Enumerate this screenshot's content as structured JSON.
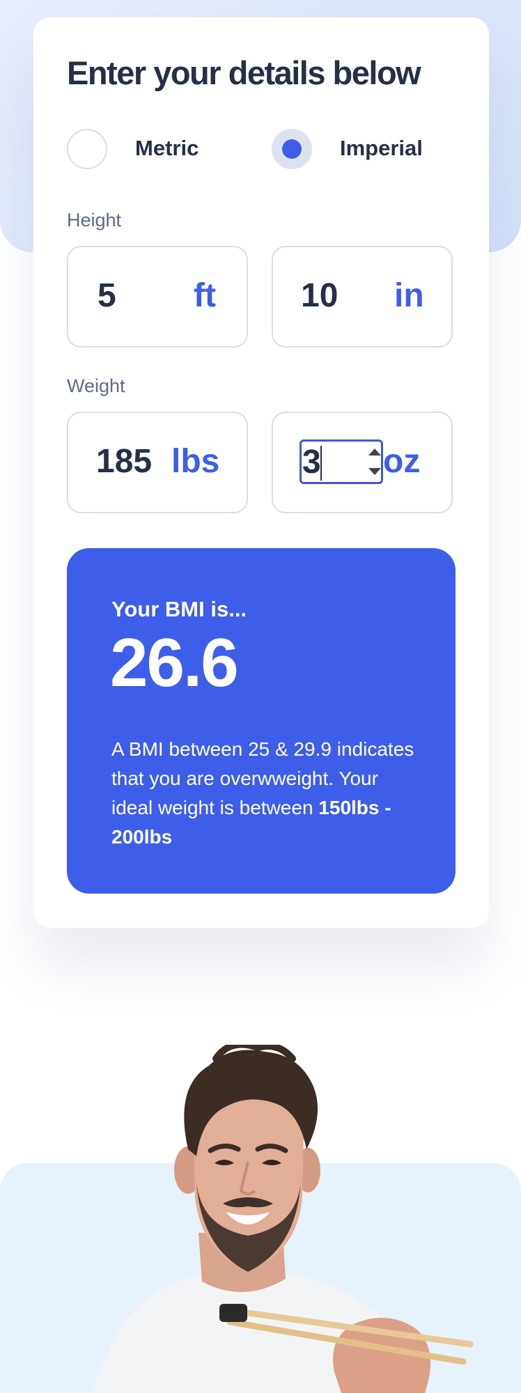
{
  "form": {
    "title": "Enter your details below",
    "units": [
      {
        "label": "Metric",
        "selected": false
      },
      {
        "label": "Imperial",
        "selected": true
      }
    ],
    "height": {
      "label": "Height",
      "ft_value": "5",
      "ft_unit": "ft",
      "in_value": "10",
      "in_unit": "in"
    },
    "weight": {
      "label": "Weight",
      "lbs_value": "185",
      "lbs_unit": "lbs",
      "oz_value": "3",
      "oz_unit": "oz"
    }
  },
  "result": {
    "heading": "Your BMI is...",
    "value": "26.6",
    "description": "A BMI between 25 & 29.9 indicates that you are overwweight. Your ideal weight is between",
    "ideal_range": "150lbs - 200lbs"
  },
  "colors": {
    "accent": "#3d5ee9",
    "heading": "#253047",
    "muted": "#5d6b85",
    "top_background": "#e0e8fa",
    "bottom_background": "#e6f2fc"
  },
  "image": {
    "subject": "smiling-man-with-chopsticks"
  }
}
